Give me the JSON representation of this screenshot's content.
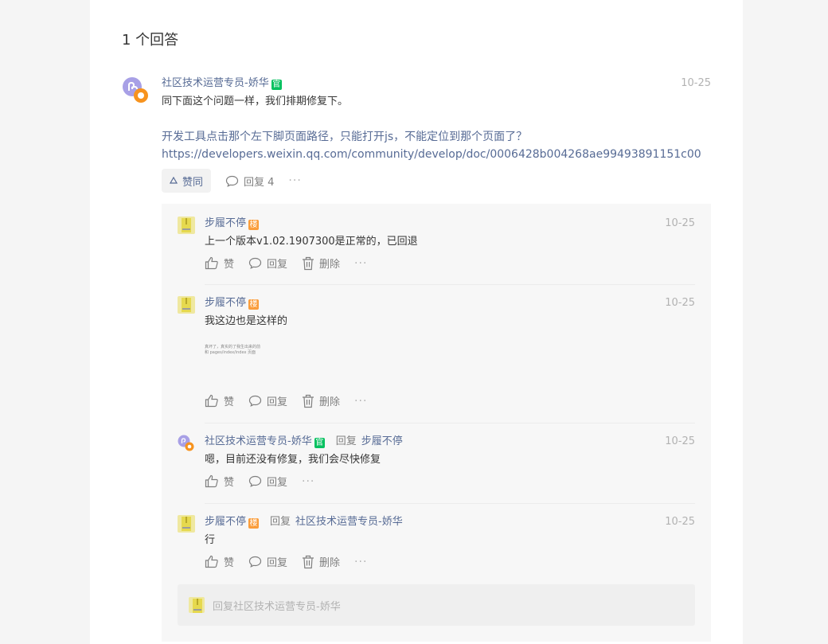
{
  "answers_count_title": "1 个回答",
  "answer": {
    "author": "社区技术运营专员-娇华",
    "badge": "官",
    "time": "10-25",
    "content_line1": "同下面这个问题一样，我们排期修复下。",
    "content_line2": "开发工具点击那个左下脚页面路径，只能打开js，不能定位到那个页面了？",
    "content_link": "https://developers.weixin.qq.com/community/develop/doc/0006428b004268ae99493891151c00",
    "like_label": "赞同",
    "reply_label": "回复 4",
    "more": "···"
  },
  "replies": [
    {
      "author": "步履不停",
      "badge": "楼",
      "time": "10-25",
      "content": "上一个版本v1.02.1907300是正常的，已回退",
      "like": "赞",
      "reply": "回复",
      "delete": "删除",
      "more": "···"
    },
    {
      "author": "步履不停",
      "badge": "楼",
      "time": "10-25",
      "content": "我这边也是这样的",
      "image_text_1": "真坏了，真实的了我生出来的前",
      "image_text_2": "和 pages/index/index 页面",
      "like": "赞",
      "reply": "回复",
      "delete": "删除",
      "more": "···"
    },
    {
      "author": "社区技术运营专员-娇华",
      "badge": "官",
      "reply_word": "回复",
      "reply_to": "步履不停",
      "time": "10-25",
      "content": "嗯，目前还没有修复，我们会尽快修复",
      "like": "赞",
      "reply": "回复",
      "more": "···"
    },
    {
      "author": "步履不停",
      "badge": "楼",
      "reply_word": "回复",
      "reply_to": "社区技术运营专员-娇华",
      "time": "10-25",
      "content": "行",
      "like": "赞",
      "reply": "回复",
      "delete": "删除",
      "more": "···"
    }
  ],
  "reply_input": {
    "placeholder": "回复社区技术运营专员-娇华"
  },
  "colors": {
    "link": "#576b95",
    "official_badge": "#07c160",
    "floor_badge": "#fa9d3b"
  }
}
